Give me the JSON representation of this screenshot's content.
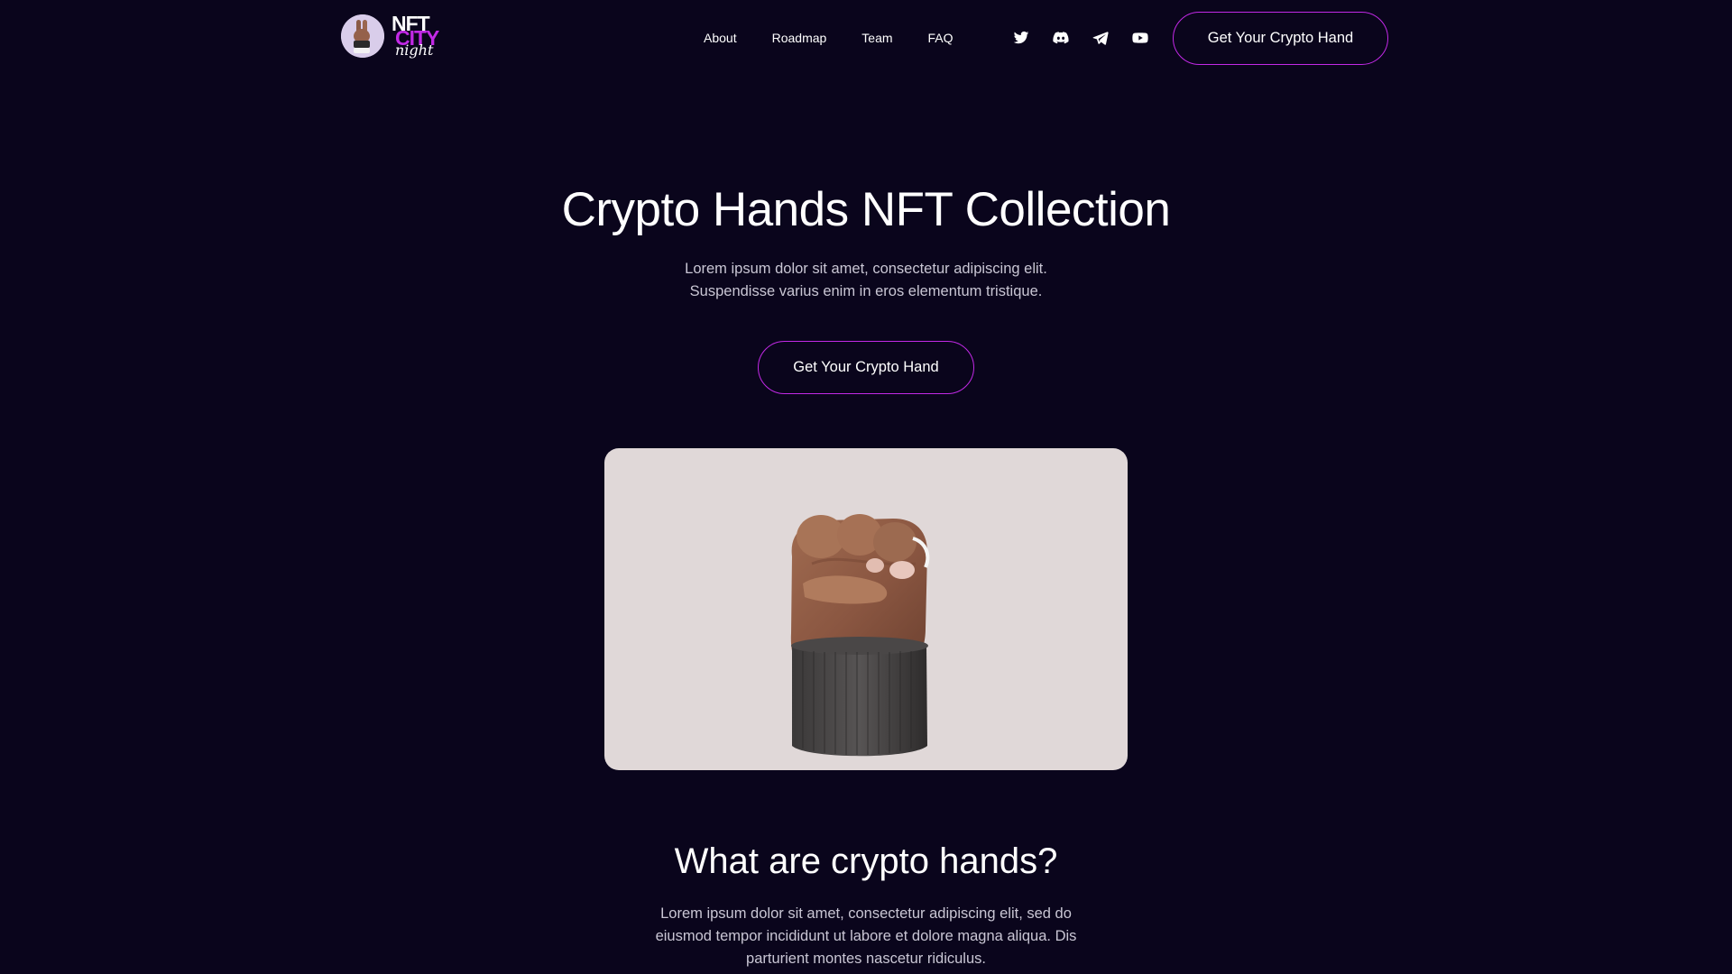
{
  "header": {
    "logo": {
      "line1": "NFT",
      "line2": "CITY",
      "line3": "night"
    },
    "nav": [
      {
        "label": "About"
      },
      {
        "label": "Roadmap"
      },
      {
        "label": "Team"
      },
      {
        "label": "FAQ"
      }
    ],
    "social": [
      {
        "icon": "twitter-icon"
      },
      {
        "icon": "discord-icon"
      },
      {
        "icon": "telegram-icon"
      },
      {
        "icon": "youtube-icon"
      }
    ],
    "cta_label": "Get Your Crypto Hand"
  },
  "hero": {
    "title": "Crypto Hands NFT Collection",
    "subtitle_line1": "Lorem ipsum dolor sit amet, consectetur adipiscing elit.",
    "subtitle_line2": "Suspendisse varius enim in eros elementum tristique.",
    "cta_label": "Get Your Crypto Hand",
    "image": "raised-fist-hand-image"
  },
  "about": {
    "title": "What are crypto hands?",
    "text": "Lorem ipsum dolor sit amet, consectetur adipiscing elit, sed do eiusmod tempor incididunt ut labore et dolore magna aliqua. Dis parturient montes nascetur ridiculus."
  },
  "colors": {
    "background": "#0a051c",
    "accent": "#c229e6",
    "card": "#e0d8d8",
    "muted_text": "#c9c6d4"
  }
}
